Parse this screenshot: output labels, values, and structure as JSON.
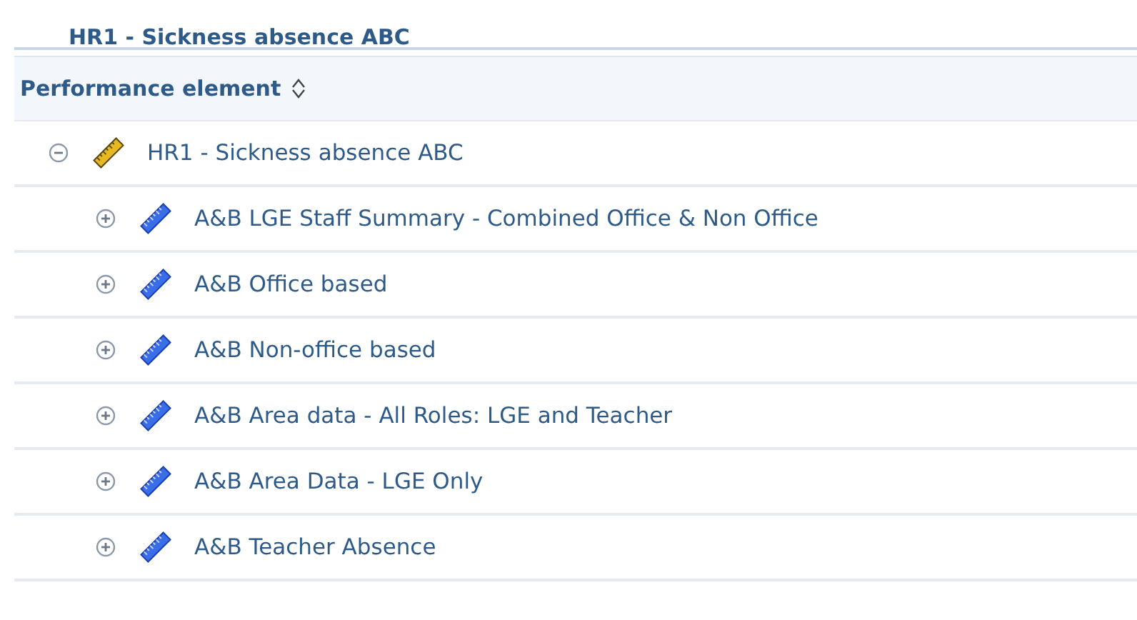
{
  "title": "HR1 - Sickness absence ABC",
  "column_header": {
    "label": "Performance element"
  },
  "tree": [
    {
      "label": "HR1 - Sickness absence ABC",
      "expanded": true,
      "children": [
        {
          "label": "A&B LGE Staff Summary - Combined Office & Non Office",
          "expanded": false
        },
        {
          "label": "A&B Office based",
          "expanded": false
        },
        {
          "label": "A&B Non-office based",
          "expanded": false
        },
        {
          "label": "A&B Area data - All Roles: LGE and Teacher",
          "expanded": false
        },
        {
          "label": "A&B Area Data - LGE Only",
          "expanded": false
        },
        {
          "label": "A&B Teacher Absence",
          "expanded": false
        }
      ]
    }
  ]
}
